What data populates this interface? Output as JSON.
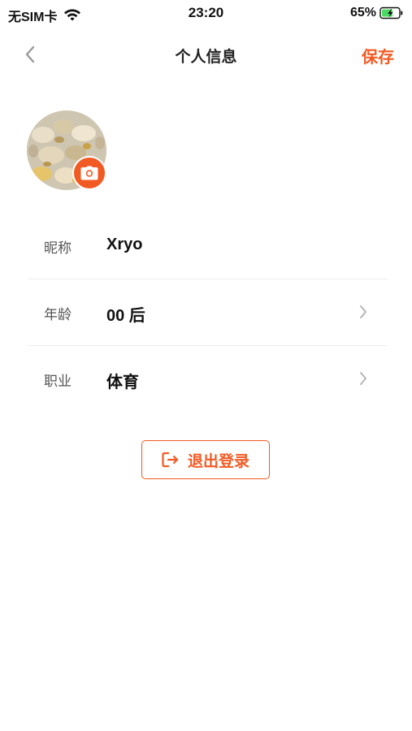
{
  "status_bar": {
    "carrier": "无SIM卡",
    "time": "23:20",
    "battery_percent": "65%",
    "battery_level": 0.65,
    "wifi_icon": "wifi-icon",
    "battery_icon": "battery-charging-icon"
  },
  "nav": {
    "title": "个人信息",
    "save_label": "保存",
    "back_icon": "chevron-left-icon"
  },
  "avatar": {
    "camera_icon": "camera-icon"
  },
  "profile": {
    "rows": [
      {
        "label": "昵称",
        "value": "Xryo",
        "has_arrow": false
      },
      {
        "label": "年龄",
        "value": "00 后",
        "has_arrow": true
      },
      {
        "label": "职业",
        "value": "体育",
        "has_arrow": true
      }
    ]
  },
  "logout": {
    "label": "退出登录",
    "icon": "logout-icon"
  },
  "colors": {
    "accent": "#F25A23",
    "battery_green": "#4CD964"
  }
}
